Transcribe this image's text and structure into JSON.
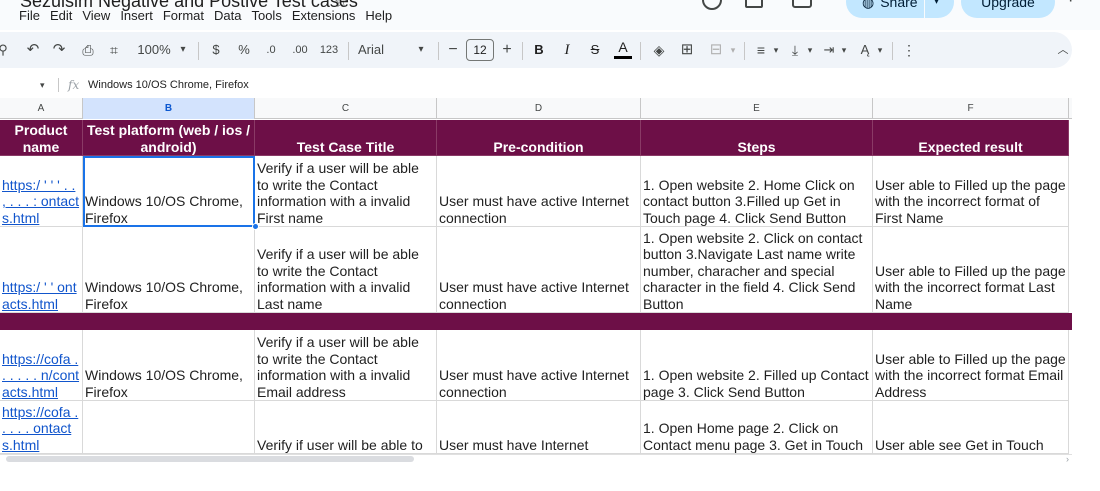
{
  "title_bar": {
    "doc_title": "Sezuisim Negative and Postive Test cases",
    "share_label": "Share",
    "upgrade_label": "Upgrade"
  },
  "menu": [
    "File",
    "Edit",
    "View",
    "Insert",
    "Format",
    "Data",
    "Tools",
    "Extensions",
    "Help"
  ],
  "toolbar": {
    "zoom": "100%",
    "currency": "$",
    "percent": "%",
    "decrease_decimal": ".0",
    "increase_decimal": ".00",
    "number_format": "123",
    "font_name": "Arial",
    "font_size": "12",
    "bold": "B",
    "italic": "I",
    "strike": "S",
    "text_color": "A"
  },
  "formula_bar": {
    "value": "Windows 10/OS Chrome, Firefox"
  },
  "columns": [
    "A",
    "B",
    "C",
    "D",
    "E",
    "F"
  ],
  "header_row": [
    "Product name",
    "Test platform (web / ios / android)",
    "Test Case Title",
    "Pre-condition",
    "Steps",
    "Expected result"
  ],
  "rows": [
    {
      "product": "https:/ '  '  ' .  .  ,  .  .  . :  ontacts.html",
      "platform": "Windows 10/OS Chrome, Firefox",
      "title": "Verify if a user will be able to write the Contact information with a invalid First name",
      "precondition": "User must have active Internet connection",
      "steps": "1. Open website 2. Home Click on contact button 3.Filled up Get in Touch page 4. Click Send Button",
      "expected": "User able to Filled up the page with the incorrect format of First Name"
    },
    {
      "product": "https:/  '  '  ontacts.html",
      "platform": "Windows 10/OS Chrome, Firefox",
      "title": "Verify if a user will be able to  write the Contact information  with a invalid Last name",
      "precondition": "User must have active Internet connection",
      "steps": "1. Open website 2. Click on contact button 3.Navigate Last name write number, characher and special character in the field 4. Click Send Button",
      "expected": "User able to Filled up the page with the incorrect format Last Name"
    },
    {
      "product": "https://cofa  .  .  .  .  .  .  n/contacts.html",
      "platform": "Windows 10/OS Chrome, Firefox",
      "title": "Verify if a user will be able to write the Contact information  with a invalid Email address",
      "precondition": "User must have active Internet connection",
      "steps": "1. Open website 2. Filled up Contact page 3. Click Send Button",
      "expected": "User able to Filled up the page with the incorrect format Email Address"
    },
    {
      "product": "https://cofa  .  .  .  .  .  ontacts.html",
      "platform": "",
      "title": "Verify if user will be able to",
      "precondition": "User must have Internet",
      "steps": "1. Open Home page  2. Click on Contact menu page 3. Get in Touch",
      "expected": "User able see Get in Touch"
    }
  ],
  "colors": {
    "header_bg": "#6d0f47",
    "link": "#1155cc",
    "selection": "#1a73e8",
    "share_bg": "#c2e7ff"
  }
}
